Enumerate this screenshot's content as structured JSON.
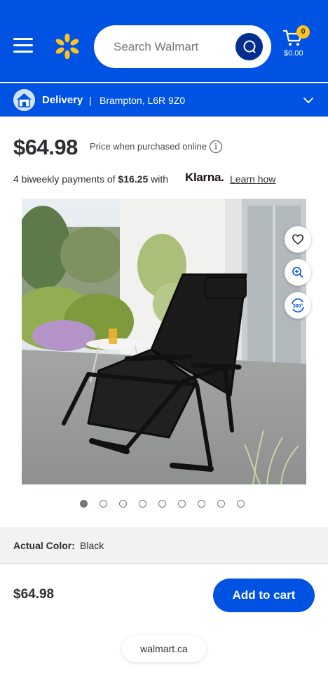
{
  "header": {
    "search_placeholder": "Search Walmart",
    "cart_count": "0",
    "cart_total": "$0.00",
    "brand_color": "#0053e2",
    "spark_color": "#ffc220"
  },
  "delivery": {
    "label": "Delivery",
    "separator": "|",
    "location": "Brampton, L6R 9Z0"
  },
  "product": {
    "price": "$64.98",
    "price_note": "Price when purchased online",
    "info_glyph": "i",
    "klarna": {
      "prefix": "4 biweekly payments of ",
      "amount": "$16.25",
      "suffix": " with",
      "brand": "Klarna.",
      "link": "Learn how"
    },
    "image_count": 9,
    "active_image_index": 0,
    "actions": [
      "heart-icon",
      "zoom-in-icon",
      "360-view-icon"
    ],
    "view_360_label": "360°",
    "color_label": "Actual Color:",
    "color_value": "Black"
  },
  "bottom_bar": {
    "price": "$64.98",
    "add_to_cart": "Add to cart"
  },
  "browser": {
    "url": "walmart.ca"
  }
}
